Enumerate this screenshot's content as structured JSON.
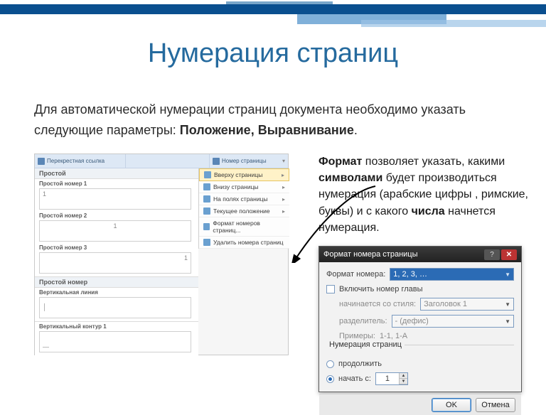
{
  "slide": {
    "title": "Нумерация страниц",
    "para_lead": "Для автоматической нумерации страниц документа необходимо указать следующие параметры:  ",
    "para_bold": "Положение, Выравнивание",
    "para_tail": ".",
    "right_p1a": "Формат",
    "right_p1b": " позволяет указать, какими ",
    "right_p1c": "символами",
    "right_p1d": " будет производиться нумерация (арабские цифры , римские, буквы) и с какого ",
    "right_p1e": "числа",
    "right_p1f": " начнется нумерация."
  },
  "word_panel": {
    "ribbon": {
      "crossref": "Перекрестная ссылка",
      "pagenum": "Номер страницы"
    },
    "menu": [
      "Вверху страницы",
      "Внизу страницы",
      "На полях страницы",
      "Текущее положение",
      "Формат номеров страниц...",
      "Удалить номера страниц"
    ],
    "gallery": {
      "header": "Простой",
      "items": [
        "Простой номер 1",
        "Простой номер 2",
        "Простой номер 3"
      ],
      "header2": "Простой номер",
      "sub2": "Вертикальная линия",
      "header3": "Вертикальный контур 1"
    }
  },
  "dialog": {
    "title": "Формат номера страницы",
    "lbl_format": "Формат номера:",
    "format_value": "1, 2, 3, …",
    "chk_chapter": "Включить номер главы",
    "lbl_style": "начинается со стиля:",
    "style_value": "Заголовок 1",
    "lbl_sep": "разделитель:",
    "sep_value": "- (дефис)",
    "lbl_examples": "Примеры:",
    "examples_value": "1-1, 1-A",
    "group": "Нумерация страниц",
    "radio_continue": "продолжить",
    "radio_startat": "начать с:",
    "start_value": "1",
    "btn_ok": "OK",
    "btn_cancel": "Отмена"
  }
}
